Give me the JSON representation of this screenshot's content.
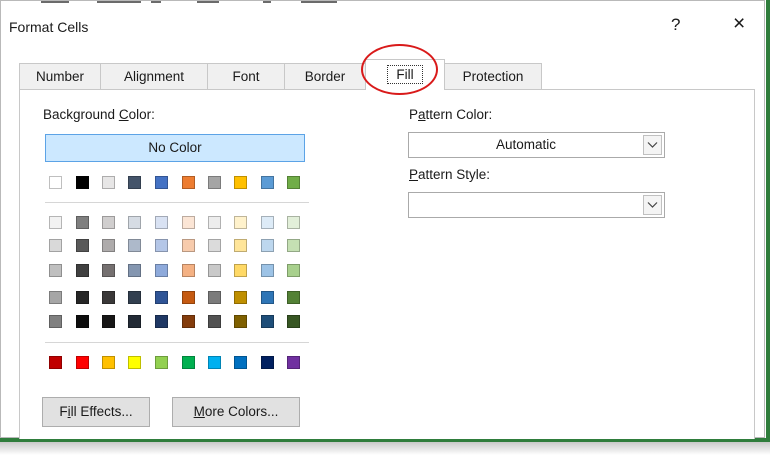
{
  "dialog": {
    "title": "Format Cells",
    "help": "?",
    "close": "×"
  },
  "tabs": [
    {
      "label": "Number"
    },
    {
      "label": "Alignment"
    },
    {
      "label": "Font"
    },
    {
      "label": "Border"
    },
    {
      "label": "Fill",
      "active": true
    },
    {
      "label": "Protection"
    }
  ],
  "fill": {
    "background_color_label_pre": "Background ",
    "background_color_label_key": "C",
    "background_color_label_post": "olor:",
    "no_color": "No Color",
    "theme_top_row": [
      "#ffffff",
      "#000000",
      "#e7e6e6",
      "#44546a",
      "#4472c4",
      "#ed7d31",
      "#a5a5a5",
      "#ffc000",
      "#5b9bd5",
      "#70ad47"
    ],
    "tint_rows": [
      [
        "#f2f2f2",
        "#7f7f7f",
        "#d0cece",
        "#d6dce4",
        "#d9e2f3",
        "#fbe5d5",
        "#ededed",
        "#fff2cc",
        "#ddebf7",
        "#e2efd9"
      ],
      [
        "#d9d9d9",
        "#595959",
        "#aeabab",
        "#adb9ca",
        "#b4c6e7",
        "#f7cbac",
        "#dbdbdb",
        "#ffe599",
        "#bdd7ee",
        "#c5e0b3"
      ],
      [
        "#bfbfbf",
        "#404040",
        "#757070",
        "#8496b0",
        "#8eaadb",
        "#f4b183",
        "#c9c9c9",
        "#ffd966",
        "#9dc3e6",
        "#a8d08d"
      ],
      [
        "#a6a6a6",
        "#262626",
        "#3a3838",
        "#323f4f",
        "#2f5496",
        "#c55a11",
        "#7b7b7b",
        "#bf8f00",
        "#2e75b6",
        "#538135"
      ],
      [
        "#808080",
        "#0d0d0d",
        "#171616",
        "#222a35",
        "#1f3864",
        "#843c0c",
        "#525252",
        "#7f6000",
        "#1e4e79",
        "#375623"
      ]
    ],
    "standard_row": [
      "#c00000",
      "#ff0000",
      "#ffc000",
      "#ffff00",
      "#92d050",
      "#00b050",
      "#00b0f0",
      "#0070c0",
      "#002060",
      "#7030a0"
    ],
    "fill_effects_pre": "F",
    "fill_effects_key": "i",
    "fill_effects_post": "ll Effects...",
    "more_colors_key": "M",
    "more_colors_post": "ore Colors...",
    "pattern_color_pre": "P",
    "pattern_color_key": "a",
    "pattern_color_post": "ttern Color:",
    "pattern_color_value": "Automatic",
    "pattern_style_key": "P",
    "pattern_style_post": "attern Style:",
    "pattern_style_value": ""
  },
  "colors": {
    "annotation": "#d91a1a",
    "selected_bg": "#cce8ff",
    "window_border": "#2f7d3c"
  }
}
